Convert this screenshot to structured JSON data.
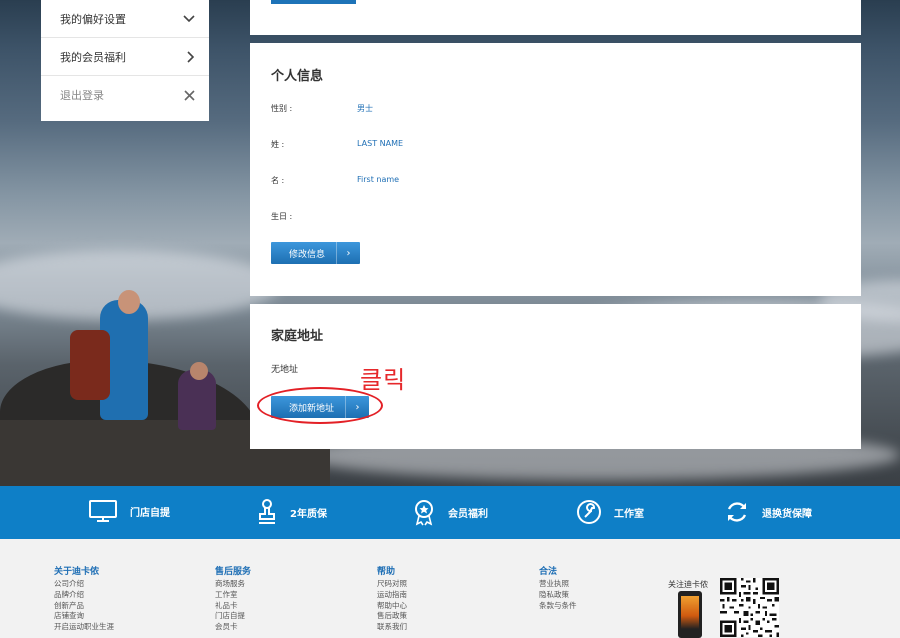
{
  "sidebar": {
    "items": [
      {
        "label": "我的偏好设置",
        "icon": "chevron-down-icon"
      },
      {
        "label": "我的会员福利",
        "icon": "chevron-right-icon"
      },
      {
        "label": "退出登录",
        "icon": "close-icon"
      }
    ]
  },
  "personal_info": {
    "title": "个人信息",
    "fields": [
      {
        "label": "性别 :",
        "value": "男士"
      },
      {
        "label": "姓 :",
        "value": "LAST NAME"
      },
      {
        "label": "名 :",
        "value": "First name"
      },
      {
        "label": "生日 :",
        "value": ""
      }
    ],
    "edit_button": "修改信息"
  },
  "home_address": {
    "title": "家庭地址",
    "empty_text": "无地址",
    "add_button": "添加新地址"
  },
  "annotation": {
    "text": "클릭",
    "color": "#e32026"
  },
  "features": [
    {
      "label": "门店自提",
      "icon": "monitor-icon"
    },
    {
      "label": "2年质保",
      "icon": "stamp-icon"
    },
    {
      "label": "会员福利",
      "icon": "award-icon"
    },
    {
      "label": "工作室",
      "icon": "wrench-icon"
    },
    {
      "label": "退换货保障",
      "icon": "refresh-icon"
    }
  ],
  "footer": {
    "columns": [
      {
        "title": "关于迪卡侬",
        "links": [
          "公司介绍",
          "品牌介绍",
          "创新产品",
          "店铺查询",
          "开启运动职业生涯"
        ]
      },
      {
        "title": "售后服务",
        "links": [
          "商场服务",
          "工作室",
          "礼品卡",
          "门店自提",
          "会员卡"
        ]
      },
      {
        "title": "帮助",
        "links": [
          "尺码对照",
          "运动指南",
          "帮助中心",
          "售后政策",
          "联系我们"
        ]
      },
      {
        "title": "合法",
        "links": [
          "营业执照",
          "隐私政策",
          "条款与条件"
        ]
      }
    ],
    "follow_label": "关注迪卡侬"
  },
  "colors": {
    "accent": "#1f6fb5",
    "feature_bar": "#0e7fc7",
    "annotation": "#e32026"
  }
}
